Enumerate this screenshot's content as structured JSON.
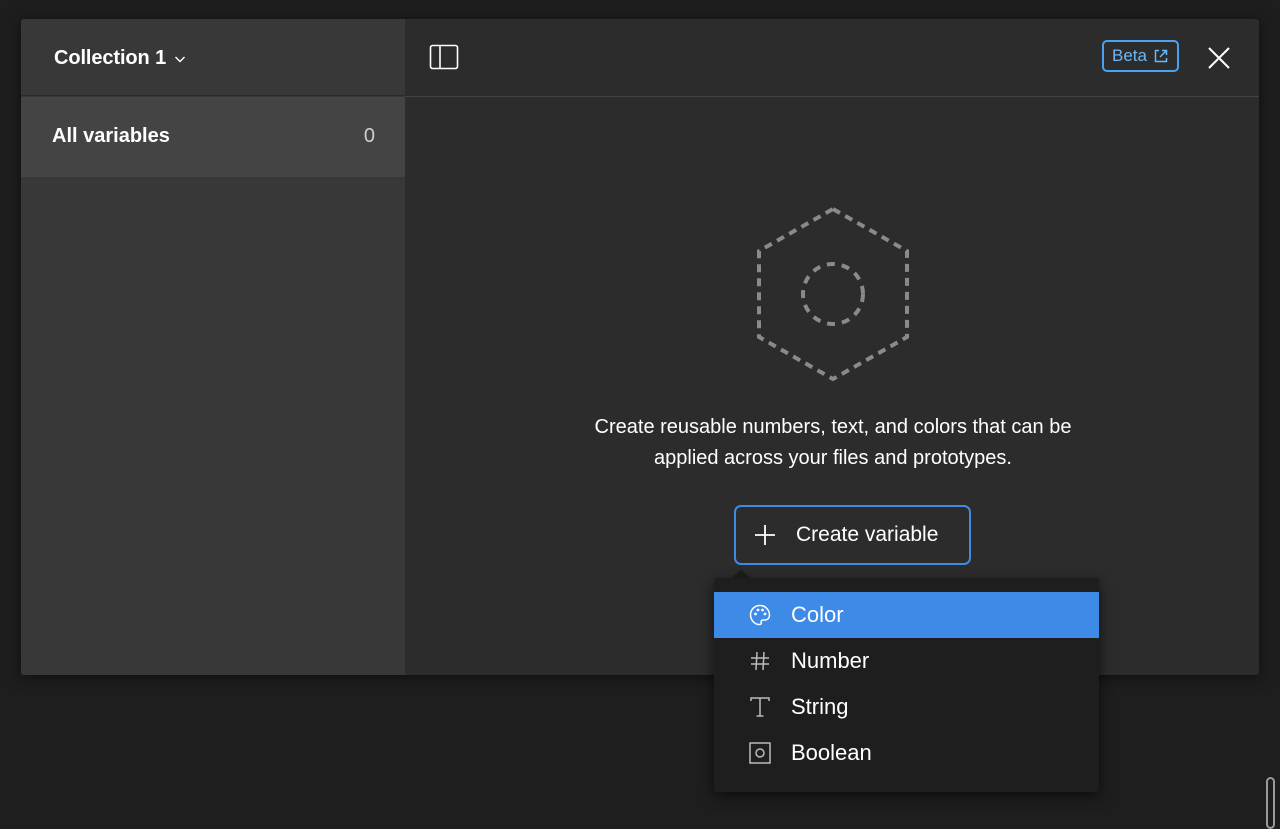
{
  "sidebar": {
    "collection_name": "Collection 1",
    "items": [
      {
        "label": "All variables",
        "count": "0"
      }
    ]
  },
  "header": {
    "beta_label": "Beta"
  },
  "empty_state": {
    "message_line1": "Create reusable numbers, text, and colors that can be",
    "message_line2": "applied across your files and prototypes."
  },
  "create_button": {
    "label": "Create variable"
  },
  "menu": {
    "items": [
      {
        "label": "Color",
        "icon": "palette-icon",
        "selected": true
      },
      {
        "label": "Number",
        "icon": "hash-icon",
        "selected": false
      },
      {
        "label": "String",
        "icon": "text-icon",
        "selected": false
      },
      {
        "label": "Boolean",
        "icon": "boolean-icon",
        "selected": false
      }
    ]
  },
  "colors": {
    "accent": "#3d8be6",
    "beta": "#4aa3f0",
    "modal_bg": "#2c2c2c",
    "sidebar_bg": "#383838",
    "menu_bg": "#1e1e1e"
  }
}
